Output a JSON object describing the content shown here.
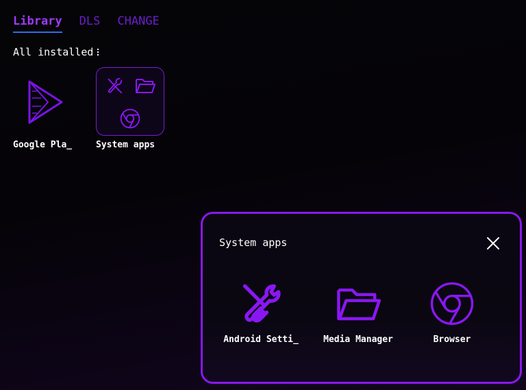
{
  "tabs": [
    {
      "label": "Library"
    },
    {
      "label": "DLS"
    },
    {
      "label": "CHANGE"
    }
  ],
  "filter": {
    "label": "All installed"
  },
  "apps": [
    {
      "label": "Google Pla_",
      "icon": "play-store-icon"
    },
    {
      "label": "System apps",
      "icon": "folder-group-icon"
    }
  ],
  "panel": {
    "title": "System apps",
    "apps": [
      {
        "label": "Android Setti_",
        "icon": "tools-icon"
      },
      {
        "label": "Media Manager",
        "icon": "folder-icon"
      },
      {
        "label": "Browser",
        "icon": "chrome-icon"
      }
    ]
  },
  "colors": {
    "accent": "#8a17f2",
    "tab_inactive": "#6a1fc9",
    "underline": "#2d6ef0"
  }
}
